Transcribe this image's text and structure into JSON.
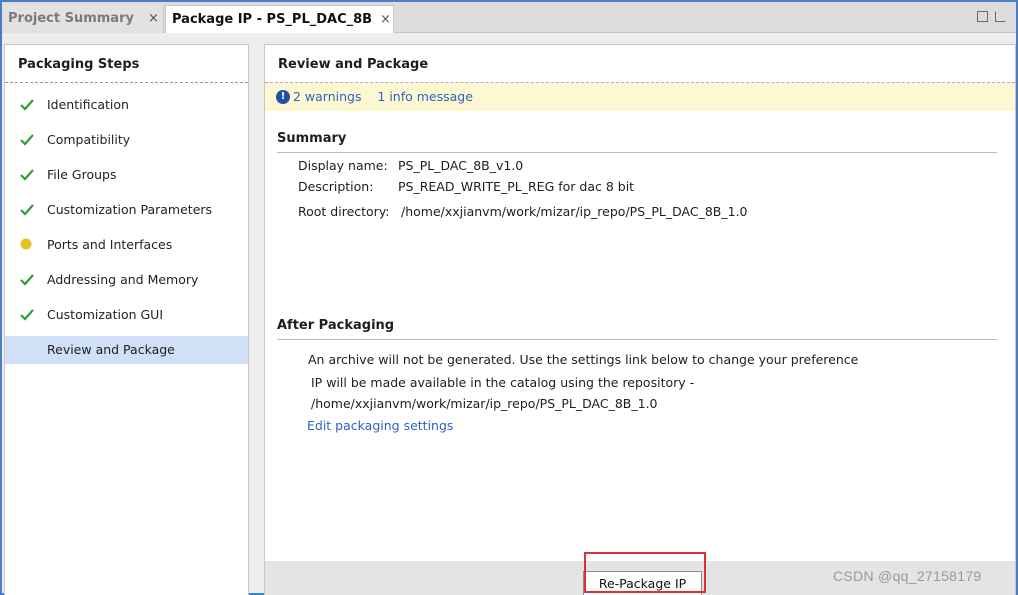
{
  "tabs": {
    "inactive_label": "Project Summary",
    "active_label": "Package IP - PS_PL_DAC_8B",
    "close_glyph": "×"
  },
  "left_panel": {
    "title": "Packaging Steps",
    "steps": [
      {
        "label": "Identification",
        "status": "check"
      },
      {
        "label": "Compatibility",
        "status": "check"
      },
      {
        "label": "File Groups",
        "status": "check"
      },
      {
        "label": "Customization Parameters",
        "status": "check"
      },
      {
        "label": "Ports and Interfaces",
        "status": "warning"
      },
      {
        "label": "Addressing and Memory",
        "status": "check"
      },
      {
        "label": "Customization GUI",
        "status": "check"
      },
      {
        "label": "Review and Package",
        "status": "selected"
      }
    ]
  },
  "right_panel": {
    "title": "Review and Package",
    "banner": {
      "warnings": "2 warnings",
      "info": "1 info message"
    },
    "summary": {
      "heading": "Summary",
      "display_name_label": "Display name:",
      "display_name_value": "PS_PL_DAC_8B_v1.0",
      "description_label": "Description:",
      "description_value": "PS_READ_WRITE_PL_REG for dac 8 bit",
      "root_dir_label": "Root directory:",
      "root_dir_value": "/home/xxjianvm/work/mizar/ip_repo/PS_PL_DAC_8B_1.0"
    },
    "after": {
      "heading": "After Packaging",
      "line1": "An archive will not be generated. Use the settings link below to change your preference",
      "line2": "IP will be made available in the catalog using the repository -",
      "line3": "/home/xxjianvm/work/mizar/ip_repo/PS_PL_DAC_8B_1.0",
      "edit_link": "Edit packaging settings"
    },
    "button_label": "Re-Package IP"
  },
  "watermark": "CSDN @qq_27158179",
  "colors": {
    "check": "#2e9e3a",
    "warning": "#e8c020",
    "link": "#2f62c6",
    "selected_row": "#cfe0f7",
    "highlight": "#e03030"
  }
}
